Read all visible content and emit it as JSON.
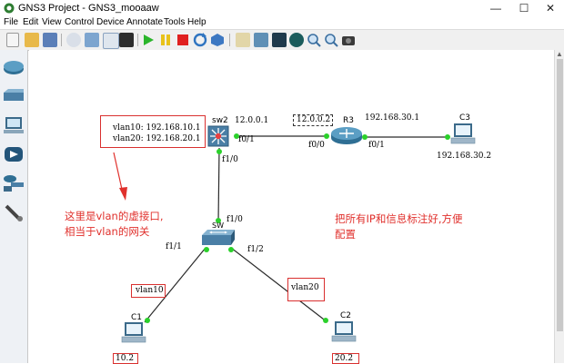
{
  "window": {
    "title": "GNS3 Project - GNS3_mooaaw",
    "controls": {
      "minimize": "—",
      "maximize": "☐",
      "close": "✕"
    }
  },
  "menu": [
    "File",
    "Edit",
    "View",
    "Control",
    "Device",
    "Annotate",
    "Tools",
    "Help"
  ],
  "toolbar": {
    "buttons": [
      "new-project-icon",
      "open-project-icon",
      "save-project-icon",
      "snapshot-icon",
      "show-interface-labels-icon",
      "add-link-icon",
      "console-icon",
      "start-all-icon",
      "suspend-all-icon",
      "stop-all-icon",
      "reload-all-icon",
      "virtualbox-icon",
      "add-note-icon",
      "add-image-icon",
      "draw-rectangle-icon",
      "draw-ellipse-icon",
      "zoom-in-icon",
      "zoom-out-icon",
      "screenshot-icon"
    ]
  },
  "device_panel": [
    "router-icon",
    "switch-icon",
    "end-device-icon",
    "security-device-icon",
    "all-devices-icon",
    "add-link-icon"
  ],
  "topology": {
    "vlan_note_line1": "vlan10: 192.168.10.1",
    "vlan_note_line2": "vlan20: 192.168.20.1",
    "sw2": {
      "name": "sw2",
      "ip": "12.0.0.1",
      "port_right": "f0/1",
      "port_down": "f1/0"
    },
    "r3": {
      "name": "R3",
      "ip_left": "12.0.0.2",
      "ip_right": "192.168.30.1",
      "port_left": "f0/0",
      "port_right": "f0/1"
    },
    "c3": {
      "name": "C3",
      "ip": "192.168.30.2"
    },
    "sw": {
      "name": "SW",
      "port_up": "f1/0",
      "port_left": "f1/1",
      "port_right": "f1/2"
    },
    "c1": {
      "name": "C1",
      "ip": "10.2",
      "vlan": "vlan10"
    },
    "c2": {
      "name": "C2",
      "ip": "20.2",
      "vlan": "vlan20"
    },
    "annotation_left_line1": "这里是vlan的虚接口,",
    "annotation_left_line2": "相当于vlan的网关",
    "annotation_right_line1": "把所有IP和信息标注好,方便",
    "annotation_right_line2": "配置"
  },
  "colors": {
    "link": "#2a2a2a",
    "port_up": "#2bd12b",
    "annotation": "#e0302c",
    "router": "#2f6f94",
    "switch": "#4a7fa6"
  }
}
